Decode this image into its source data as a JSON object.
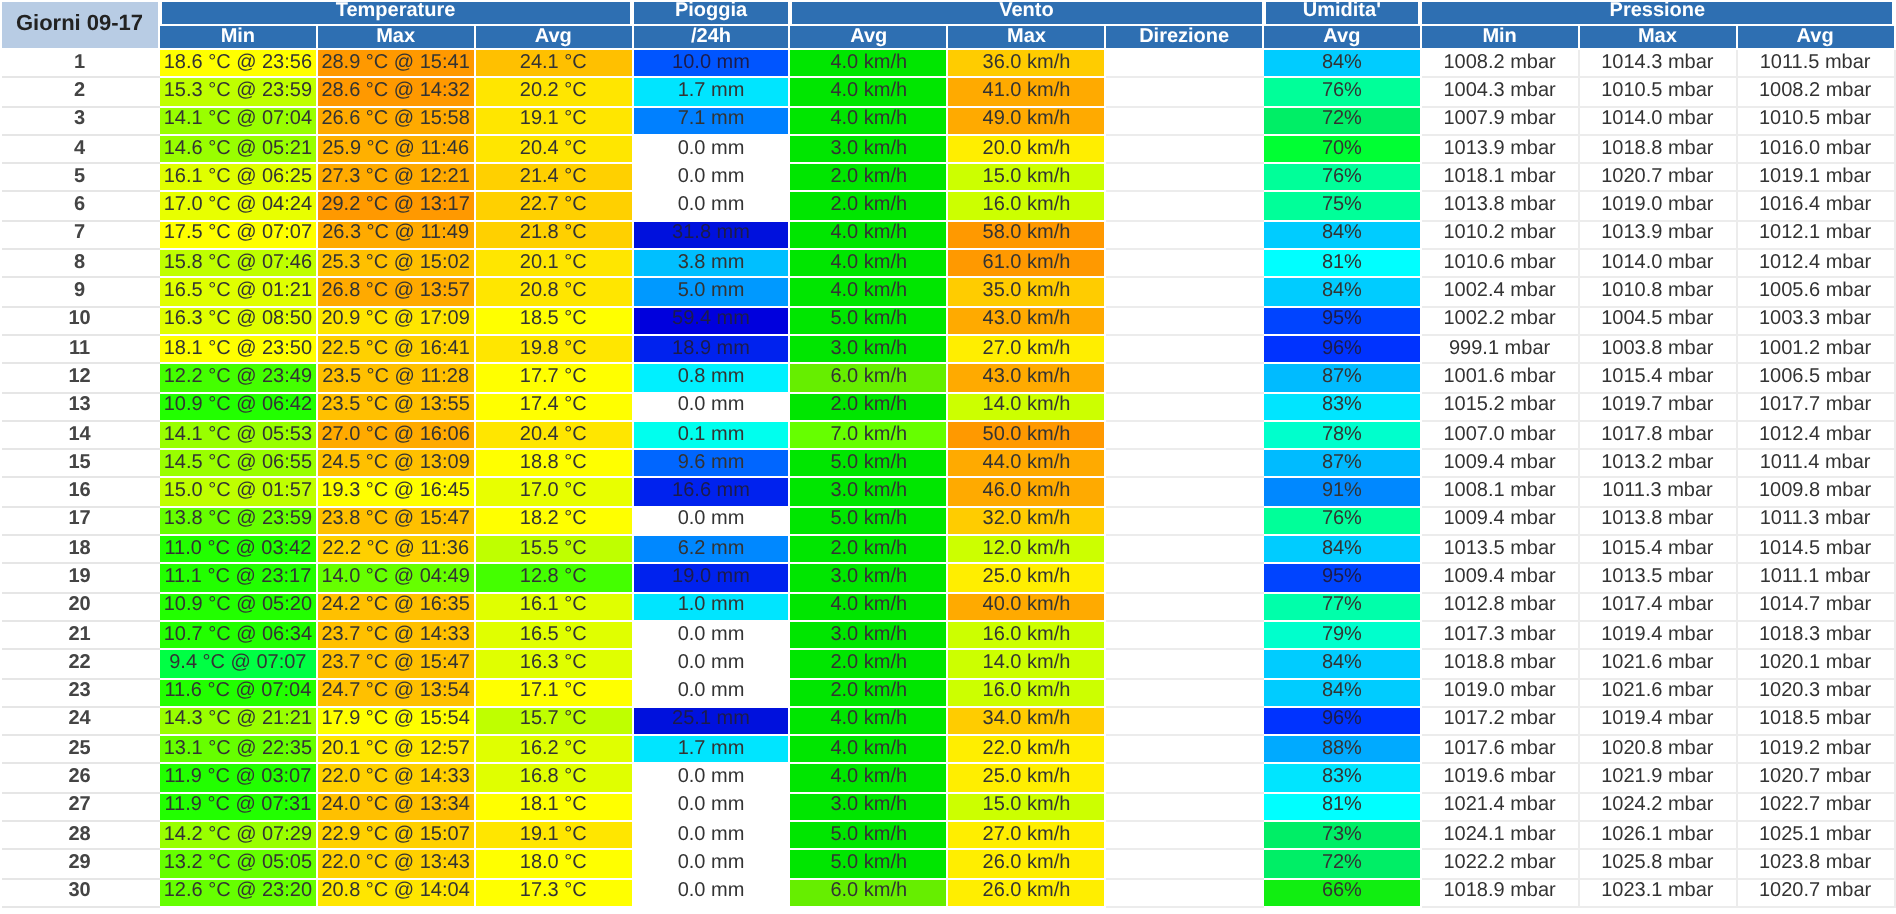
{
  "table": {
    "corner": "Giorni 09-17",
    "groups": [
      {
        "label": "Temperature",
        "columns": [
          "Min",
          "Max",
          "Avg"
        ]
      },
      {
        "label": "Pioggia",
        "columns": [
          "/24h"
        ]
      },
      {
        "label": "Vento",
        "columns": [
          "Avg",
          "Max",
          "Direzione"
        ]
      },
      {
        "label": "Umidita'",
        "columns": [
          "Avg"
        ]
      },
      {
        "label": "Pressione",
        "columns": [
          "Min",
          "Max",
          "Avg"
        ]
      }
    ],
    "rows": [
      {
        "day": "1",
        "cells": [
          {
            "text": "18.6 °C @ 23:56",
            "color": "#ffff00"
          },
          {
            "text": "28.9 °C @ 15:41",
            "color": "#ff9900"
          },
          {
            "text": "24.1 °C",
            "color": "#ffc000"
          },
          {
            "text": "10.0 mm",
            "color": "#0055ff"
          },
          {
            "text": "4.0 km/h",
            "color": "#00e600"
          },
          {
            "text": "36.0 km/h",
            "color": "#ffcc00"
          },
          {
            "text": "84%",
            "color": "#00ccff"
          }
        ],
        "pressure": [
          "1008.2 mbar",
          "1014.3 mbar",
          "1011.5 mbar"
        ]
      },
      {
        "day": "2",
        "cells": [
          {
            "text": "15.3 °C @ 23:59",
            "color": "#bfff00"
          },
          {
            "text": "28.6 °C @ 14:32",
            "color": "#ff9900"
          },
          {
            "text": "20.2 °C",
            "color": "#ffe600"
          },
          {
            "text": "1.7 mm",
            "color": "#00e5ff"
          },
          {
            "text": "4.0 km/h",
            "color": "#00e600"
          },
          {
            "text": "41.0 km/h",
            "color": "#ffaa00"
          },
          {
            "text": "76%",
            "color": "#00ff99"
          }
        ],
        "pressure": [
          "1004.3 mbar",
          "1010.5 mbar",
          "1008.2 mbar"
        ]
      },
      {
        "day": "3",
        "cells": [
          {
            "text": "14.1 °C @ 07:04",
            "color": "#99ff00"
          },
          {
            "text": "26.6 °C @ 15:58",
            "color": "#ffaa00"
          },
          {
            "text": "19.1 °C",
            "color": "#ffe600"
          },
          {
            "text": "7.1 mm",
            "color": "#0080ff"
          },
          {
            "text": "4.0 km/h",
            "color": "#00e600"
          },
          {
            "text": "49.0 km/h",
            "color": "#ffaa00"
          },
          {
            "text": "72%",
            "color": "#00ee66"
          }
        ],
        "pressure": [
          "1007.9 mbar",
          "1014.0 mbar",
          "1010.5 mbar"
        ]
      },
      {
        "day": "4",
        "cells": [
          {
            "text": "14.6 °C @ 05:21",
            "color": "#99ff00"
          },
          {
            "text": "25.9 °C @ 11:46",
            "color": "#ffb000"
          },
          {
            "text": "20.4 °C",
            "color": "#ffe600"
          },
          {
            "text": "0.0 mm",
            "color": "#ffffff"
          },
          {
            "text": "3.0 km/h",
            "color": "#00e600"
          },
          {
            "text": "20.0 km/h",
            "color": "#ffee00"
          },
          {
            "text": "70%",
            "color": "#00ff33"
          }
        ],
        "pressure": [
          "1013.9 mbar",
          "1018.8 mbar",
          "1016.0 mbar"
        ]
      },
      {
        "day": "5",
        "cells": [
          {
            "text": "16.1 °C @ 06:25",
            "color": "#e0ff00"
          },
          {
            "text": "27.3 °C @ 12:21",
            "color": "#ffaa00"
          },
          {
            "text": "21.4 °C",
            "color": "#ffd000"
          },
          {
            "text": "0.0 mm",
            "color": "#ffffff"
          },
          {
            "text": "2.0 km/h",
            "color": "#00e600"
          },
          {
            "text": "15.0 km/h",
            "color": "#ccff00"
          },
          {
            "text": "76%",
            "color": "#00ff99"
          }
        ],
        "pressure": [
          "1018.1 mbar",
          "1020.7 mbar",
          "1019.1 mbar"
        ]
      },
      {
        "day": "6",
        "cells": [
          {
            "text": "17.0 °C @ 04:24",
            "color": "#e8ff00"
          },
          {
            "text": "29.2 °C @ 13:17",
            "color": "#ff9900"
          },
          {
            "text": "22.7 °C",
            "color": "#ffd000"
          },
          {
            "text": "0.0 mm",
            "color": "#ffffff"
          },
          {
            "text": "2.0 km/h",
            "color": "#00e600"
          },
          {
            "text": "16.0 km/h",
            "color": "#ccff00"
          },
          {
            "text": "75%",
            "color": "#00ff99"
          }
        ],
        "pressure": [
          "1013.8 mbar",
          "1019.0 mbar",
          "1016.4 mbar"
        ]
      },
      {
        "day": "7",
        "cells": [
          {
            "text": "17.5 °C @ 07:07",
            "color": "#ffff00"
          },
          {
            "text": "26.3 °C @ 11:49",
            "color": "#ffaa00"
          },
          {
            "text": "21.8 °C",
            "color": "#ffd000"
          },
          {
            "text": "31.8 mm",
            "color": "#0011dd"
          },
          {
            "text": "4.0 km/h",
            "color": "#00e600"
          },
          {
            "text": "58.0 km/h",
            "color": "#ff9900"
          },
          {
            "text": "84%",
            "color": "#00ccff"
          }
        ],
        "pressure": [
          "1010.2 mbar",
          "1013.9 mbar",
          "1012.1 mbar"
        ]
      },
      {
        "day": "8",
        "cells": [
          {
            "text": "15.8 °C @ 07:46",
            "color": "#bfff00"
          },
          {
            "text": "25.3 °C @ 15:02",
            "color": "#ffc000"
          },
          {
            "text": "20.1 °C",
            "color": "#ffe600"
          },
          {
            "text": "3.8 mm",
            "color": "#00bfff"
          },
          {
            "text": "4.0 km/h",
            "color": "#00e600"
          },
          {
            "text": "61.0 km/h",
            "color": "#ff9900"
          },
          {
            "text": "81%",
            "color": "#00ffff"
          }
        ],
        "pressure": [
          "1010.6 mbar",
          "1014.0 mbar",
          "1012.4 mbar"
        ]
      },
      {
        "day": "9",
        "cells": [
          {
            "text": "16.5 °C @ 01:21",
            "color": "#e0ff00"
          },
          {
            "text": "26.8 °C @ 13:57",
            "color": "#ffaa00"
          },
          {
            "text": "20.8 °C",
            "color": "#ffe600"
          },
          {
            "text": "5.0 mm",
            "color": "#0099ff"
          },
          {
            "text": "4.0 km/h",
            "color": "#00e600"
          },
          {
            "text": "35.0 km/h",
            "color": "#ffcc00"
          },
          {
            "text": "84%",
            "color": "#00ccff"
          }
        ],
        "pressure": [
          "1002.4 mbar",
          "1010.8 mbar",
          "1005.6 mbar"
        ]
      },
      {
        "day": "10",
        "cells": [
          {
            "text": "16.3 °C @ 08:50",
            "color": "#e0ff00"
          },
          {
            "text": "20.9 °C @ 17:09",
            "color": "#ffe600"
          },
          {
            "text": "18.5 °C",
            "color": "#ffff00"
          },
          {
            "text": "59.4 mm",
            "color": "#0000dd"
          },
          {
            "text": "5.0 km/h",
            "color": "#00e600"
          },
          {
            "text": "43.0 km/h",
            "color": "#ffaa00"
          },
          {
            "text": "95%",
            "color": "#0044ff"
          }
        ],
        "pressure": [
          "1002.2 mbar",
          "1004.5 mbar",
          "1003.3 mbar"
        ]
      },
      {
        "day": "11",
        "cells": [
          {
            "text": "18.1 °C @ 23:50",
            "color": "#ffff00"
          },
          {
            "text": "22.5 °C @ 16:41",
            "color": "#ffd000"
          },
          {
            "text": "19.8 °C",
            "color": "#ffe600"
          },
          {
            "text": "18.9 mm",
            "color": "#0022ee"
          },
          {
            "text": "3.0 km/h",
            "color": "#00e600"
          },
          {
            "text": "27.0 km/h",
            "color": "#ffee00"
          },
          {
            "text": "96%",
            "color": "#0033ff"
          }
        ],
        "pressure": [
          "999.1 mbar",
          "1003.8 mbar",
          "1001.2 mbar"
        ]
      },
      {
        "day": "12",
        "cells": [
          {
            "text": "12.2 °C @ 23:49",
            "color": "#44ff00"
          },
          {
            "text": "23.5 °C @ 11:28",
            "color": "#ffc000"
          },
          {
            "text": "17.7 °C",
            "color": "#ffff00"
          },
          {
            "text": "0.8 mm",
            "color": "#00f0ff"
          },
          {
            "text": "6.0 km/h",
            "color": "#66ee00"
          },
          {
            "text": "43.0 km/h",
            "color": "#ffaa00"
          },
          {
            "text": "87%",
            "color": "#00bbff"
          }
        ],
        "pressure": [
          "1001.6 mbar",
          "1015.4 mbar",
          "1006.5 mbar"
        ]
      },
      {
        "day": "13",
        "cells": [
          {
            "text": "10.9 °C @ 06:42",
            "color": "#22ff00"
          },
          {
            "text": "23.5 °C @ 13:55",
            "color": "#ffc000"
          },
          {
            "text": "17.4 °C",
            "color": "#ffff00"
          },
          {
            "text": "0.0 mm",
            "color": "#ffffff"
          },
          {
            "text": "2.0 km/h",
            "color": "#00e600"
          },
          {
            "text": "14.0 km/h",
            "color": "#ccff00"
          },
          {
            "text": "83%",
            "color": "#00e5ff"
          }
        ],
        "pressure": [
          "1015.2 mbar",
          "1019.7 mbar",
          "1017.7 mbar"
        ]
      },
      {
        "day": "14",
        "cells": [
          {
            "text": "14.1 °C @ 05:53",
            "color": "#99ff00"
          },
          {
            "text": "27.0 °C @ 16:06",
            "color": "#ffaa00"
          },
          {
            "text": "20.4 °C",
            "color": "#ffe600"
          },
          {
            "text": "0.1 mm",
            "color": "#00ffee"
          },
          {
            "text": "7.0 km/h",
            "color": "#66ff00"
          },
          {
            "text": "50.0 km/h",
            "color": "#ff9900"
          },
          {
            "text": "78%",
            "color": "#00ffcc"
          }
        ],
        "pressure": [
          "1007.0 mbar",
          "1017.8 mbar",
          "1012.4 mbar"
        ]
      },
      {
        "day": "15",
        "cells": [
          {
            "text": "14.5 °C @ 06:55",
            "color": "#99ff00"
          },
          {
            "text": "24.5 °C @ 13:09",
            "color": "#ffc000"
          },
          {
            "text": "18.8 °C",
            "color": "#ffff00"
          },
          {
            "text": "9.6 mm",
            "color": "#0066ff"
          },
          {
            "text": "5.0 km/h",
            "color": "#00e600"
          },
          {
            "text": "44.0 km/h",
            "color": "#ffaa00"
          },
          {
            "text": "87%",
            "color": "#00bbff"
          }
        ],
        "pressure": [
          "1009.4 mbar",
          "1013.2 mbar",
          "1011.4 mbar"
        ]
      },
      {
        "day": "16",
        "cells": [
          {
            "text": "15.0 °C @ 01:57",
            "color": "#bfff00"
          },
          {
            "text": "19.3 °C @ 16:45",
            "color": "#ffff00"
          },
          {
            "text": "17.0 °C",
            "color": "#e8ff00"
          },
          {
            "text": "16.6 mm",
            "color": "#0022ee"
          },
          {
            "text": "3.0 km/h",
            "color": "#00e600"
          },
          {
            "text": "46.0 km/h",
            "color": "#ffaa00"
          },
          {
            "text": "91%",
            "color": "#0088ff"
          }
        ],
        "pressure": [
          "1008.1 mbar",
          "1011.3 mbar",
          "1009.8 mbar"
        ]
      },
      {
        "day": "17",
        "cells": [
          {
            "text": "13.8 °C @ 23:59",
            "color": "#66ff00"
          },
          {
            "text": "23.8 °C @ 15:47",
            "color": "#ffc000"
          },
          {
            "text": "18.2 °C",
            "color": "#ffff00"
          },
          {
            "text": "0.0 mm",
            "color": "#ffffff"
          },
          {
            "text": "5.0 km/h",
            "color": "#00e600"
          },
          {
            "text": "32.0 km/h",
            "color": "#ffcc00"
          },
          {
            "text": "76%",
            "color": "#00ff99"
          }
        ],
        "pressure": [
          "1009.4 mbar",
          "1013.8 mbar",
          "1011.3 mbar"
        ]
      },
      {
        "day": "18",
        "cells": [
          {
            "text": "11.0 °C @ 03:42",
            "color": "#22ff00"
          },
          {
            "text": "22.2 °C @ 11:36",
            "color": "#ffd000"
          },
          {
            "text": "15.5 °C",
            "color": "#bfff00"
          },
          {
            "text": "6.2 mm",
            "color": "#0088ff"
          },
          {
            "text": "2.0 km/h",
            "color": "#00e600"
          },
          {
            "text": "12.0 km/h",
            "color": "#ccff00"
          },
          {
            "text": "84%",
            "color": "#00ccff"
          }
        ],
        "pressure": [
          "1013.5 mbar",
          "1015.4 mbar",
          "1014.5 mbar"
        ]
      },
      {
        "day": "19",
        "cells": [
          {
            "text": "11.1 °C @ 23:17",
            "color": "#22ff00"
          },
          {
            "text": "14.0 °C @ 04:49",
            "color": "#66ff00"
          },
          {
            "text": "12.8 °C",
            "color": "#44ff00"
          },
          {
            "text": "19.0 mm",
            "color": "#0022ee"
          },
          {
            "text": "3.0 km/h",
            "color": "#00e600"
          },
          {
            "text": "25.0 km/h",
            "color": "#ffee00"
          },
          {
            "text": "95%",
            "color": "#0044ff"
          }
        ],
        "pressure": [
          "1009.4 mbar",
          "1013.5 mbar",
          "1011.1 mbar"
        ]
      },
      {
        "day": "20",
        "cells": [
          {
            "text": "10.9 °C @ 05:20",
            "color": "#22ff00"
          },
          {
            "text": "24.2 °C @ 16:35",
            "color": "#ffc000"
          },
          {
            "text": "16.1 °C",
            "color": "#e0ff00"
          },
          {
            "text": "1.0 mm",
            "color": "#00e5ff"
          },
          {
            "text": "4.0 km/h",
            "color": "#00e600"
          },
          {
            "text": "40.0 km/h",
            "color": "#ffaa00"
          },
          {
            "text": "77%",
            "color": "#00ffaa"
          }
        ],
        "pressure": [
          "1012.8 mbar",
          "1017.4 mbar",
          "1014.7 mbar"
        ]
      },
      {
        "day": "21",
        "cells": [
          {
            "text": "10.7 °C @ 06:34",
            "color": "#22ff00"
          },
          {
            "text": "23.7 °C @ 14:33",
            "color": "#ffc000"
          },
          {
            "text": "16.5 °C",
            "color": "#e0ff00"
          },
          {
            "text": "0.0 mm",
            "color": "#ffffff"
          },
          {
            "text": "3.0 km/h",
            "color": "#00e600"
          },
          {
            "text": "16.0 km/h",
            "color": "#ccff00"
          },
          {
            "text": "79%",
            "color": "#00ffcc"
          }
        ],
        "pressure": [
          "1017.3 mbar",
          "1019.4 mbar",
          "1018.3 mbar"
        ]
      },
      {
        "day": "22",
        "cells": [
          {
            "text": "9.4 °C @ 07:07",
            "color": "#00ff44"
          },
          {
            "text": "23.7 °C @ 15:47",
            "color": "#ffc000"
          },
          {
            "text": "16.3 °C",
            "color": "#e0ff00"
          },
          {
            "text": "0.0 mm",
            "color": "#ffffff"
          },
          {
            "text": "2.0 km/h",
            "color": "#00e600"
          },
          {
            "text": "14.0 km/h",
            "color": "#ccff00"
          },
          {
            "text": "84%",
            "color": "#00ccff"
          }
        ],
        "pressure": [
          "1018.8 mbar",
          "1021.6 mbar",
          "1020.1 mbar"
        ]
      },
      {
        "day": "23",
        "cells": [
          {
            "text": "11.6 °C @ 07:04",
            "color": "#22ff00"
          },
          {
            "text": "24.7 °C @ 13:54",
            "color": "#ffc000"
          },
          {
            "text": "17.1 °C",
            "color": "#ffff00"
          },
          {
            "text": "0.0 mm",
            "color": "#ffffff"
          },
          {
            "text": "2.0 km/h",
            "color": "#00e600"
          },
          {
            "text": "16.0 km/h",
            "color": "#ccff00"
          },
          {
            "text": "84%",
            "color": "#00ccff"
          }
        ],
        "pressure": [
          "1019.0 mbar",
          "1021.6 mbar",
          "1020.3 mbar"
        ]
      },
      {
        "day": "24",
        "cells": [
          {
            "text": "14.3 °C @ 21:21",
            "color": "#99ff00"
          },
          {
            "text": "17.9 °C @ 15:54",
            "color": "#ffff00"
          },
          {
            "text": "15.7 °C",
            "color": "#bfff00"
          },
          {
            "text": "25.1 mm",
            "color": "#0011dd"
          },
          {
            "text": "4.0 km/h",
            "color": "#00e600"
          },
          {
            "text": "34.0 km/h",
            "color": "#ffcc00"
          },
          {
            "text": "96%",
            "color": "#0033ff"
          }
        ],
        "pressure": [
          "1017.2 mbar",
          "1019.4 mbar",
          "1018.5 mbar"
        ]
      },
      {
        "day": "25",
        "cells": [
          {
            "text": "13.1 °C @ 22:35",
            "color": "#66ff00"
          },
          {
            "text": "20.1 °C @ 12:57",
            "color": "#ffe600"
          },
          {
            "text": "16.2 °C",
            "color": "#e0ff00"
          },
          {
            "text": "1.7 mm",
            "color": "#00e5ff"
          },
          {
            "text": "4.0 km/h",
            "color": "#00e600"
          },
          {
            "text": "22.0 km/h",
            "color": "#ffee00"
          },
          {
            "text": "88%",
            "color": "#00aaff"
          }
        ],
        "pressure": [
          "1017.6 mbar",
          "1020.8 mbar",
          "1019.2 mbar"
        ]
      },
      {
        "day": "26",
        "cells": [
          {
            "text": "11.9 °C @ 03:07",
            "color": "#22ff00"
          },
          {
            "text": "22.0 °C @ 14:33",
            "color": "#ffd000"
          },
          {
            "text": "16.8 °C",
            "color": "#e0ff00"
          },
          {
            "text": "0.0 mm",
            "color": "#ffffff"
          },
          {
            "text": "4.0 km/h",
            "color": "#00e600"
          },
          {
            "text": "25.0 km/h",
            "color": "#ffee00"
          },
          {
            "text": "83%",
            "color": "#00e5ff"
          }
        ],
        "pressure": [
          "1019.6 mbar",
          "1021.9 mbar",
          "1020.7 mbar"
        ]
      },
      {
        "day": "27",
        "cells": [
          {
            "text": "11.9 °C @ 07:31",
            "color": "#22ff00"
          },
          {
            "text": "24.0 °C @ 13:34",
            "color": "#ffc000"
          },
          {
            "text": "18.1 °C",
            "color": "#ffff00"
          },
          {
            "text": "0.0 mm",
            "color": "#ffffff"
          },
          {
            "text": "3.0 km/h",
            "color": "#00e600"
          },
          {
            "text": "15.0 km/h",
            "color": "#ccff00"
          },
          {
            "text": "81%",
            "color": "#00ffff"
          }
        ],
        "pressure": [
          "1021.4 mbar",
          "1024.2 mbar",
          "1022.7 mbar"
        ]
      },
      {
        "day": "28",
        "cells": [
          {
            "text": "14.2 °C @ 07:29",
            "color": "#99ff00"
          },
          {
            "text": "22.9 °C @ 15:07",
            "color": "#ffd000"
          },
          {
            "text": "19.1 °C",
            "color": "#ffe600"
          },
          {
            "text": "0.0 mm",
            "color": "#ffffff"
          },
          {
            "text": "5.0 km/h",
            "color": "#00e600"
          },
          {
            "text": "27.0 km/h",
            "color": "#ffee00"
          },
          {
            "text": "73%",
            "color": "#00ee66"
          }
        ],
        "pressure": [
          "1024.1 mbar",
          "1026.1 mbar",
          "1025.1 mbar"
        ]
      },
      {
        "day": "29",
        "cells": [
          {
            "text": "13.2 °C @ 05:05",
            "color": "#66ff00"
          },
          {
            "text": "22.0 °C @ 13:43",
            "color": "#ffd000"
          },
          {
            "text": "18.0 °C",
            "color": "#ffff00"
          },
          {
            "text": "0.0 mm",
            "color": "#ffffff"
          },
          {
            "text": "5.0 km/h",
            "color": "#00e600"
          },
          {
            "text": "26.0 km/h",
            "color": "#ffee00"
          },
          {
            "text": "72%",
            "color": "#00ee66"
          }
        ],
        "pressure": [
          "1022.2 mbar",
          "1025.8 mbar",
          "1023.8 mbar"
        ]
      },
      {
        "day": "30",
        "cells": [
          {
            "text": "12.6 °C @ 23:20",
            "color": "#66ff00"
          },
          {
            "text": "20.8 °C @ 14:04",
            "color": "#ffe600"
          },
          {
            "text": "17.3 °C",
            "color": "#ffff00"
          },
          {
            "text": "0.0 mm",
            "color": "#ffffff"
          },
          {
            "text": "6.0 km/h",
            "color": "#66ee00"
          },
          {
            "text": "26.0 km/h",
            "color": "#ffee00"
          },
          {
            "text": "66%",
            "color": "#11ee11"
          }
        ],
        "pressure": [
          "1018.9 mbar",
          "1023.1 mbar",
          "1020.7 mbar"
        ]
      }
    ]
  }
}
